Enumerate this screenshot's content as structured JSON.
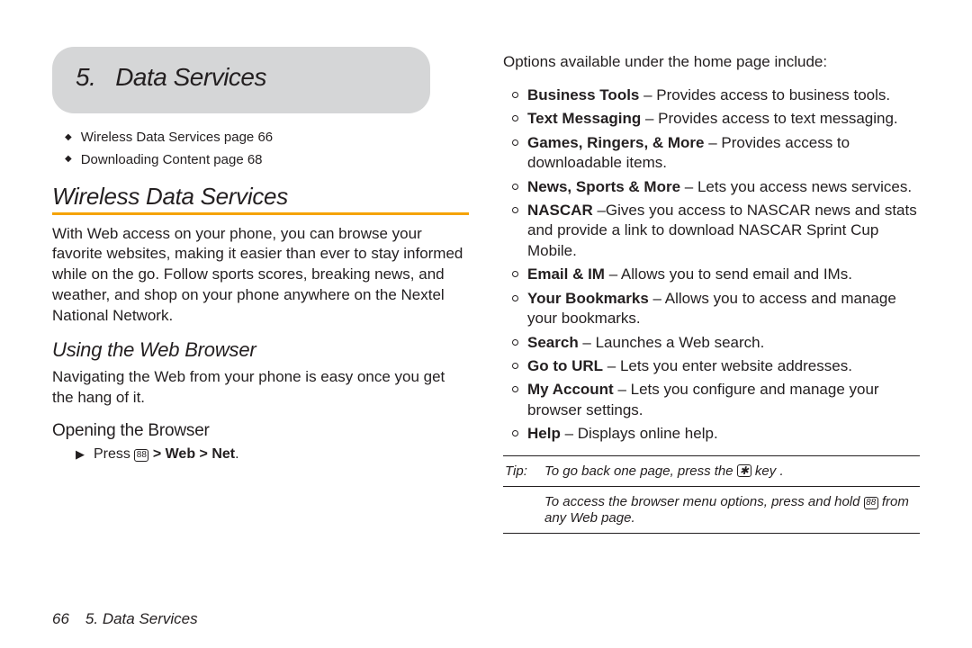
{
  "header": {
    "chapter_num": "5.",
    "chapter_title": "Data Services"
  },
  "toc": [
    {
      "label": "Wireless Data Services page 66"
    },
    {
      "label": "Downloading Content page 68"
    }
  ],
  "section1": {
    "title": "Wireless Data Services",
    "p1": "With Web access on your phone, you can browse your favorite websites, making it easier than ever to stay informed while on the go. Follow sports scores, breaking news, and weather, and shop on your phone anywhere on the Nextel National Network."
  },
  "section2": {
    "title": "Using the Web Browser",
    "p1": "Navigating the Web from your phone is easy once you get the hang of it."
  },
  "section3": {
    "title": "Opening the Browser"
  },
  "step1": {
    "pre": "Press",
    "icon": "88",
    "post": " > ",
    "b1": "Web",
    "mid": " > ",
    "b2": "Net",
    "end": "."
  },
  "rightIntro": "Options available under the home page include:",
  "options": [
    {
      "b": "Business Tools",
      "t": " – Provides access to business tools."
    },
    {
      "b": "Text Messaging",
      "t": " – Provides access to text messaging."
    },
    {
      "b": "Games, Ringers, & More",
      "t": " – Provides access to downloadable items."
    },
    {
      "b": "News, Sports & More",
      "t": " – Lets you access news services."
    },
    {
      "b": "NASCAR",
      "t": " –Gives you access to NASCAR news and stats and provide a link to download NASCAR Sprint Cup Mobile."
    },
    {
      "b": "Email & IM",
      "t": " – Allows you to send email and IMs."
    },
    {
      "b": "Your Bookmarks",
      "t": " – Allows you to access and manage your bookmarks."
    },
    {
      "b": "Search",
      "t": " – Launches a Web search."
    },
    {
      "b": "Go to URL",
      "t": " – Lets you enter website addresses."
    },
    {
      "b": "My Account",
      "t": " – Lets you configure and manage your browser settings."
    },
    {
      "b": "Help",
      "t": " – Displays online help."
    }
  ],
  "tip": {
    "label": "Tip:",
    "line1a": "To go back one page, press the ",
    "key": "✱",
    "line1b": " key .",
    "line2a": "To access the browser menu options, press and hold ",
    "key2": "88",
    "line2b": " from any Web page."
  },
  "footer": {
    "page": "66",
    "crumb": "5. Data Services"
  }
}
